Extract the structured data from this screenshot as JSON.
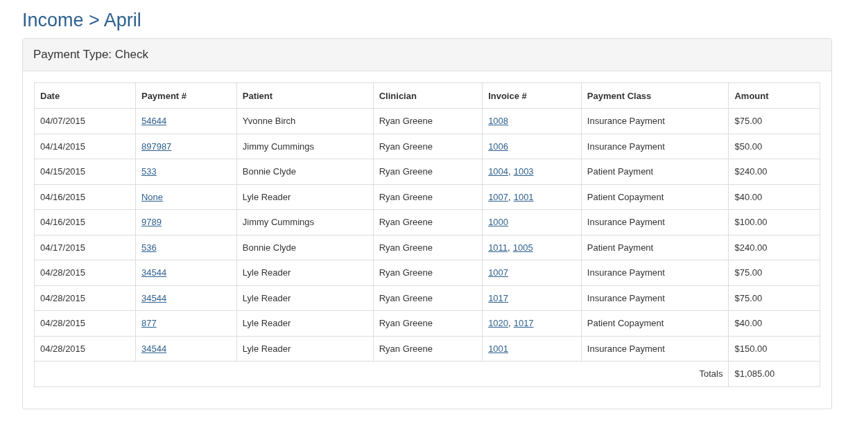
{
  "title": "Income > April",
  "panel": {
    "heading": "Payment Type: Check"
  },
  "table": {
    "columns": [
      "Date",
      "Payment #",
      "Patient",
      "Clinician",
      "Invoice #",
      "Payment Class",
      "Amount"
    ],
    "rows": [
      {
        "date": "04/07/2015",
        "payment": "54644",
        "patient": "Yvonne Birch",
        "clinician": "Ryan Greene",
        "invoices": [
          {
            "number": "1008"
          }
        ],
        "payment_class": "Insurance Payment",
        "amount": "$75.00"
      },
      {
        "date": "04/14/2015",
        "payment": "897987",
        "patient": "Jimmy Cummings",
        "clinician": "Ryan Greene",
        "invoices": [
          {
            "number": "1006"
          }
        ],
        "payment_class": "Insurance Payment",
        "amount": "$50.00"
      },
      {
        "date": "04/15/2015",
        "payment": "533",
        "patient": "Bonnie Clyde",
        "clinician": "Ryan Greene",
        "invoices": [
          {
            "number": "1004",
            "separator": ","
          },
          {
            "number": "1003"
          }
        ],
        "payment_class": "Patient Payment",
        "amount": "$240.00"
      },
      {
        "date": "04/16/2015",
        "payment": "None",
        "patient": "Lyle Reader",
        "clinician": "Ryan Greene",
        "invoices": [
          {
            "number": "1007",
            "separator": ","
          },
          {
            "number": "1001"
          }
        ],
        "payment_class": "Patient Copayment",
        "amount": "$40.00"
      },
      {
        "date": "04/16/2015",
        "payment": "9789",
        "patient": "Jimmy Cummings",
        "clinician": "Ryan Greene",
        "invoices": [
          {
            "number": "1000"
          }
        ],
        "payment_class": "Insurance Payment",
        "amount": "$100.00"
      },
      {
        "date": "04/17/2015",
        "payment": "536",
        "patient": "Bonnie Clyde",
        "clinician": "Ryan Greene",
        "invoices": [
          {
            "number": "1011",
            "separator": ","
          },
          {
            "number": "1005"
          }
        ],
        "payment_class": "Patient Payment",
        "amount": "$240.00"
      },
      {
        "date": "04/28/2015",
        "payment": "34544",
        "patient": "Lyle Reader",
        "clinician": "Ryan Greene",
        "invoices": [
          {
            "number": "1007"
          }
        ],
        "payment_class": "Insurance Payment",
        "amount": "$75.00"
      },
      {
        "date": "04/28/2015",
        "payment": "34544",
        "patient": "Lyle Reader",
        "clinician": "Ryan Greene",
        "invoices": [
          {
            "number": "1017"
          }
        ],
        "payment_class": "Insurance Payment",
        "amount": "$75.00"
      },
      {
        "date": "04/28/2015",
        "payment": "877",
        "patient": "Lyle Reader",
        "clinician": "Ryan Greene",
        "invoices": [
          {
            "number": "1020",
            "separator": ","
          },
          {
            "number": "1017"
          }
        ],
        "payment_class": "Patient Copayment",
        "amount": "$40.00"
      },
      {
        "date": "04/28/2015",
        "payment": "34544",
        "patient": "Lyle Reader",
        "clinician": "Ryan Greene",
        "invoices": [
          {
            "number": "1001"
          }
        ],
        "payment_class": "Insurance Payment",
        "amount": "$150.00"
      }
    ],
    "totals": {
      "label": "Totals",
      "amount": "$1,085.00"
    }
  }
}
